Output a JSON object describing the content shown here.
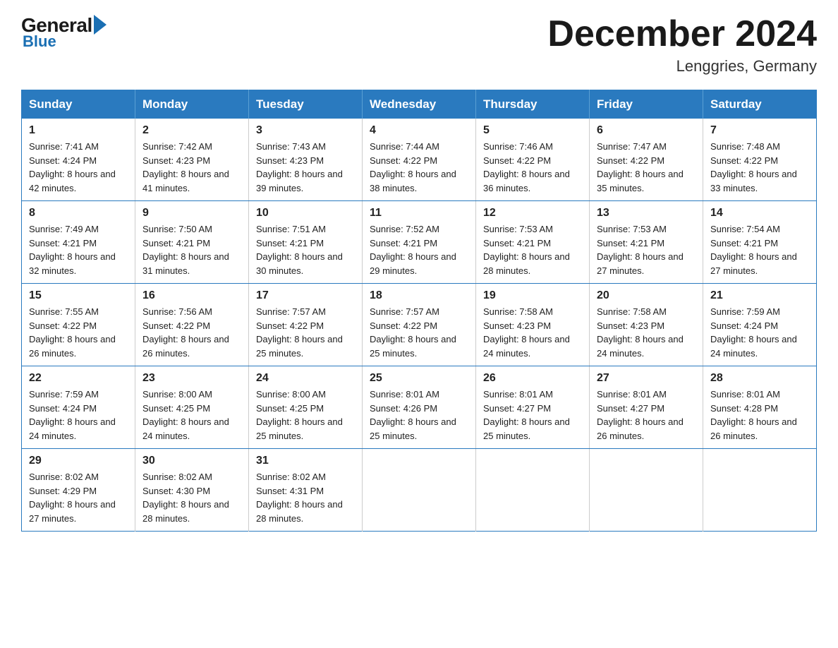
{
  "header": {
    "logo": {
      "text_general": "General",
      "text_blue": "Blue",
      "arrow": true
    },
    "month_title": "December 2024",
    "location": "Lenggries, Germany"
  },
  "days_of_week": [
    "Sunday",
    "Monday",
    "Tuesday",
    "Wednesday",
    "Thursday",
    "Friday",
    "Saturday"
  ],
  "weeks": [
    [
      {
        "day": "1",
        "sunrise": "7:41 AM",
        "sunset": "4:24 PM",
        "daylight": "8 hours and 42 minutes."
      },
      {
        "day": "2",
        "sunrise": "7:42 AM",
        "sunset": "4:23 PM",
        "daylight": "8 hours and 41 minutes."
      },
      {
        "day": "3",
        "sunrise": "7:43 AM",
        "sunset": "4:23 PM",
        "daylight": "8 hours and 39 minutes."
      },
      {
        "day": "4",
        "sunrise": "7:44 AM",
        "sunset": "4:22 PM",
        "daylight": "8 hours and 38 minutes."
      },
      {
        "day": "5",
        "sunrise": "7:46 AM",
        "sunset": "4:22 PM",
        "daylight": "8 hours and 36 minutes."
      },
      {
        "day": "6",
        "sunrise": "7:47 AM",
        "sunset": "4:22 PM",
        "daylight": "8 hours and 35 minutes."
      },
      {
        "day": "7",
        "sunrise": "7:48 AM",
        "sunset": "4:22 PM",
        "daylight": "8 hours and 33 minutes."
      }
    ],
    [
      {
        "day": "8",
        "sunrise": "7:49 AM",
        "sunset": "4:21 PM",
        "daylight": "8 hours and 32 minutes."
      },
      {
        "day": "9",
        "sunrise": "7:50 AM",
        "sunset": "4:21 PM",
        "daylight": "8 hours and 31 minutes."
      },
      {
        "day": "10",
        "sunrise": "7:51 AM",
        "sunset": "4:21 PM",
        "daylight": "8 hours and 30 minutes."
      },
      {
        "day": "11",
        "sunrise": "7:52 AM",
        "sunset": "4:21 PM",
        "daylight": "8 hours and 29 minutes."
      },
      {
        "day": "12",
        "sunrise": "7:53 AM",
        "sunset": "4:21 PM",
        "daylight": "8 hours and 28 minutes."
      },
      {
        "day": "13",
        "sunrise": "7:53 AM",
        "sunset": "4:21 PM",
        "daylight": "8 hours and 27 minutes."
      },
      {
        "day": "14",
        "sunrise": "7:54 AM",
        "sunset": "4:21 PM",
        "daylight": "8 hours and 27 minutes."
      }
    ],
    [
      {
        "day": "15",
        "sunrise": "7:55 AM",
        "sunset": "4:22 PM",
        "daylight": "8 hours and 26 minutes."
      },
      {
        "day": "16",
        "sunrise": "7:56 AM",
        "sunset": "4:22 PM",
        "daylight": "8 hours and 26 minutes."
      },
      {
        "day": "17",
        "sunrise": "7:57 AM",
        "sunset": "4:22 PM",
        "daylight": "8 hours and 25 minutes."
      },
      {
        "day": "18",
        "sunrise": "7:57 AM",
        "sunset": "4:22 PM",
        "daylight": "8 hours and 25 minutes."
      },
      {
        "day": "19",
        "sunrise": "7:58 AM",
        "sunset": "4:23 PM",
        "daylight": "8 hours and 24 minutes."
      },
      {
        "day": "20",
        "sunrise": "7:58 AM",
        "sunset": "4:23 PM",
        "daylight": "8 hours and 24 minutes."
      },
      {
        "day": "21",
        "sunrise": "7:59 AM",
        "sunset": "4:24 PM",
        "daylight": "8 hours and 24 minutes."
      }
    ],
    [
      {
        "day": "22",
        "sunrise": "7:59 AM",
        "sunset": "4:24 PM",
        "daylight": "8 hours and 24 minutes."
      },
      {
        "day": "23",
        "sunrise": "8:00 AM",
        "sunset": "4:25 PM",
        "daylight": "8 hours and 24 minutes."
      },
      {
        "day": "24",
        "sunrise": "8:00 AM",
        "sunset": "4:25 PM",
        "daylight": "8 hours and 25 minutes."
      },
      {
        "day": "25",
        "sunrise": "8:01 AM",
        "sunset": "4:26 PM",
        "daylight": "8 hours and 25 minutes."
      },
      {
        "day": "26",
        "sunrise": "8:01 AM",
        "sunset": "4:27 PM",
        "daylight": "8 hours and 25 minutes."
      },
      {
        "day": "27",
        "sunrise": "8:01 AM",
        "sunset": "4:27 PM",
        "daylight": "8 hours and 26 minutes."
      },
      {
        "day": "28",
        "sunrise": "8:01 AM",
        "sunset": "4:28 PM",
        "daylight": "8 hours and 26 minutes."
      }
    ],
    [
      {
        "day": "29",
        "sunrise": "8:02 AM",
        "sunset": "4:29 PM",
        "daylight": "8 hours and 27 minutes."
      },
      {
        "day": "30",
        "sunrise": "8:02 AM",
        "sunset": "4:30 PM",
        "daylight": "8 hours and 28 minutes."
      },
      {
        "day": "31",
        "sunrise": "8:02 AM",
        "sunset": "4:31 PM",
        "daylight": "8 hours and 28 minutes."
      },
      null,
      null,
      null,
      null
    ]
  ],
  "labels": {
    "sunrise": "Sunrise:",
    "sunset": "Sunset:",
    "daylight": "Daylight:"
  }
}
